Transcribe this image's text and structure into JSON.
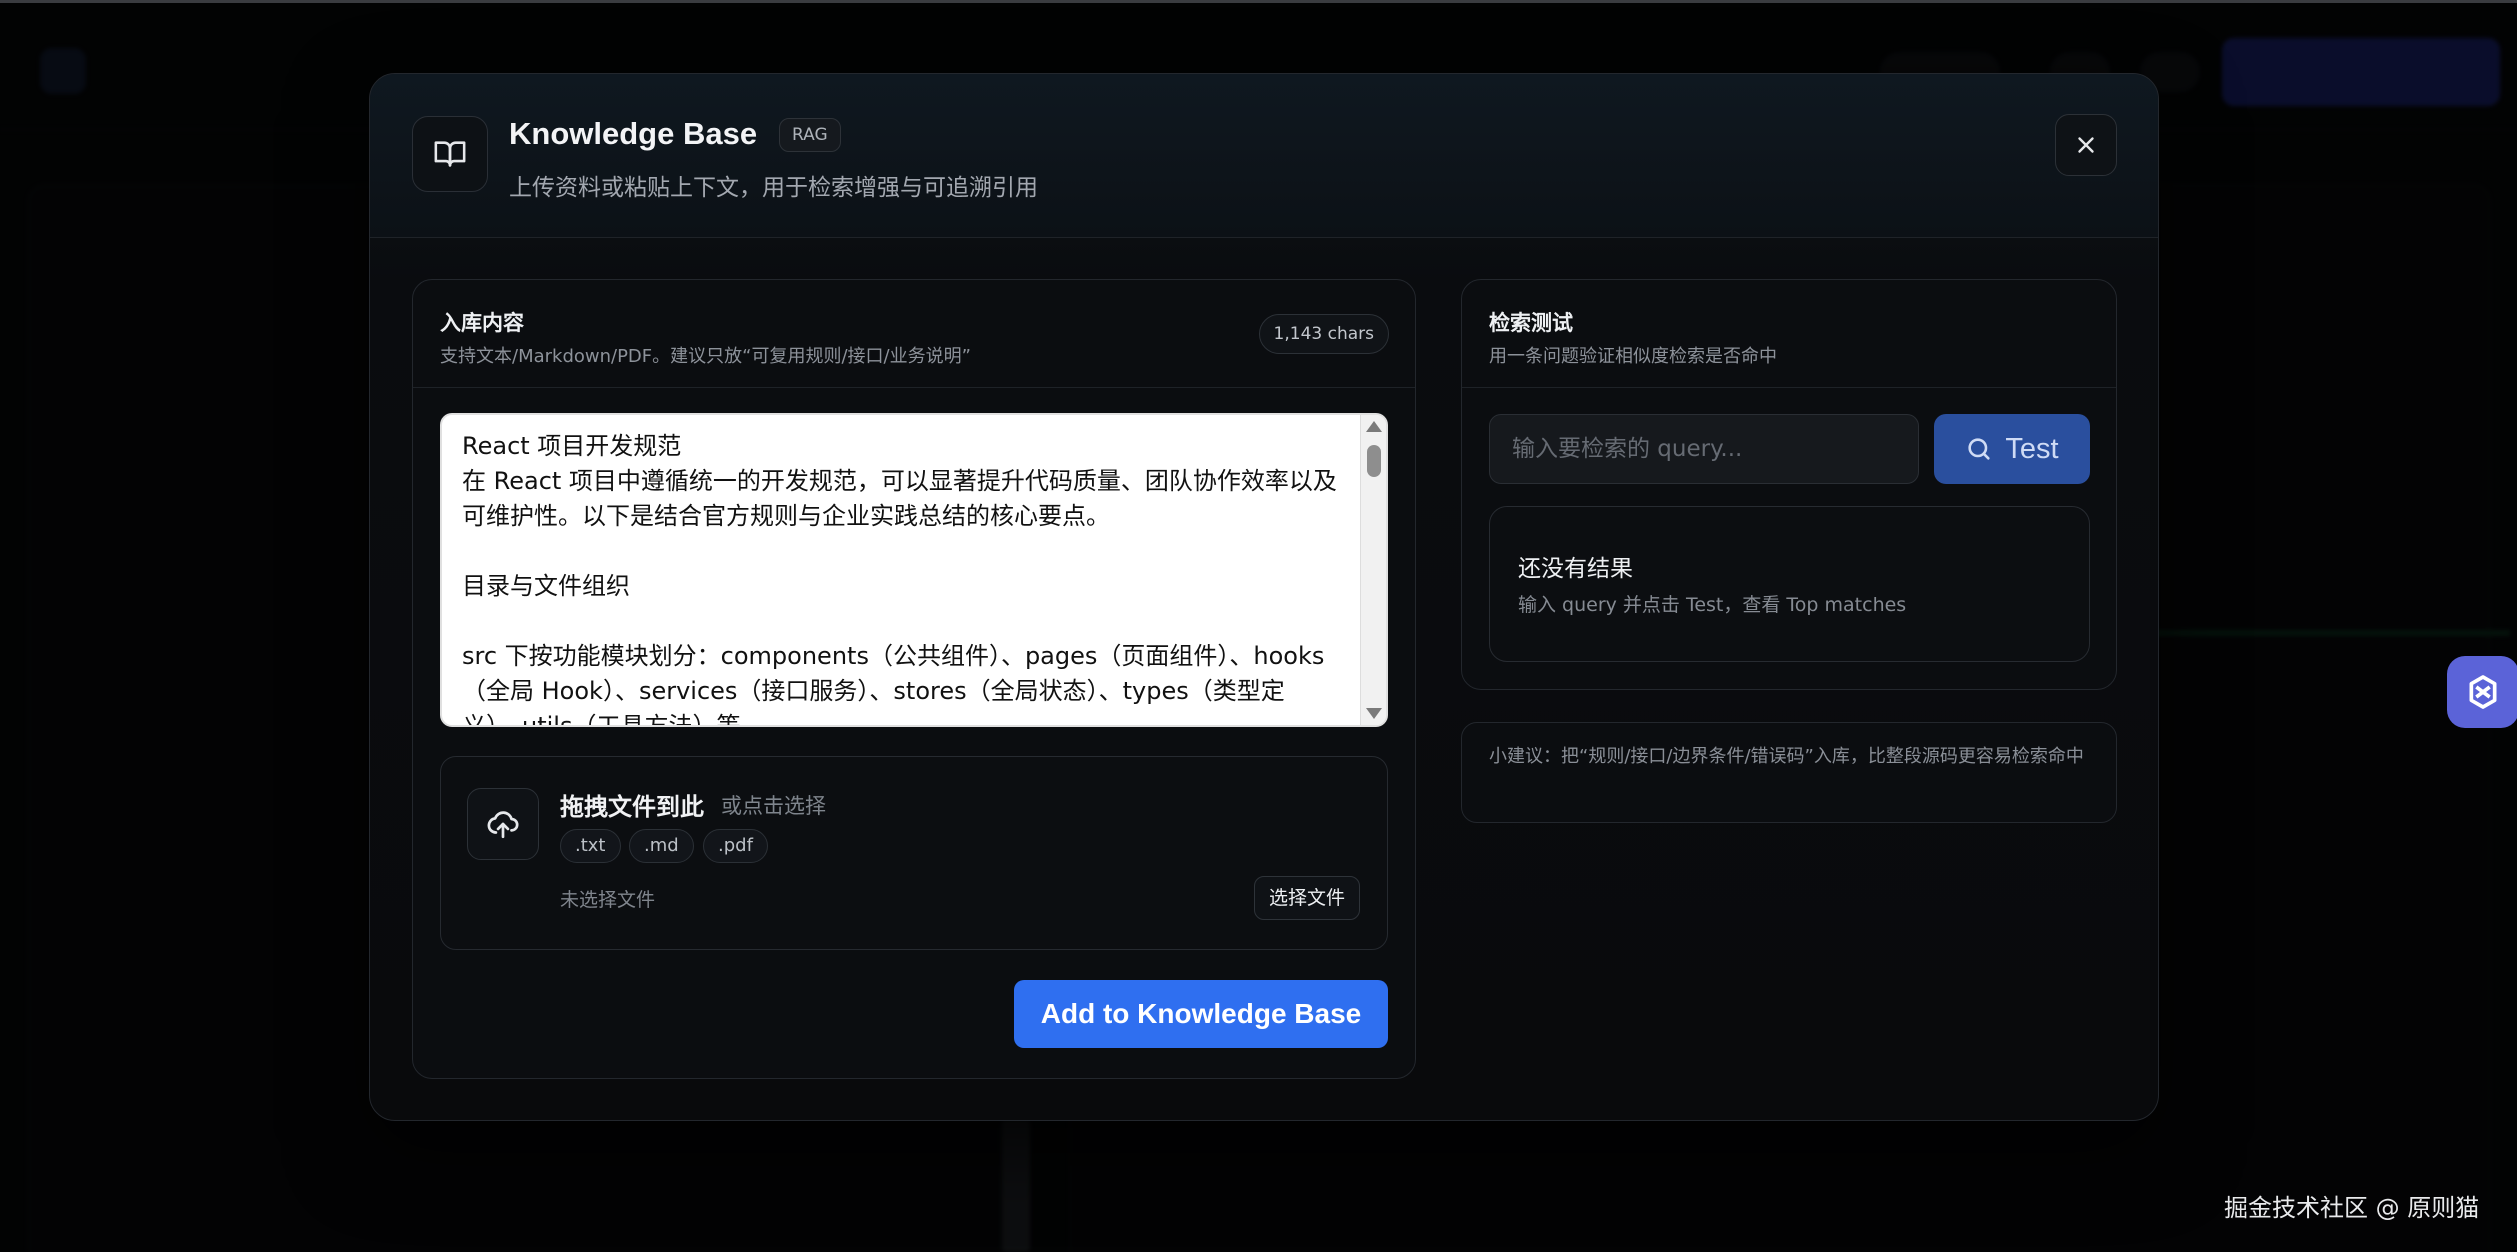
{
  "modal": {
    "title": "Knowledge Base",
    "badge": "RAG",
    "subtitle": "上传资料或粘贴上下文，用于检索增强与可追溯引用",
    "icon": "book-open-icon",
    "close_icon": "close-icon"
  },
  "ingest": {
    "title": "入库内容",
    "description": "支持文本/Markdown/PDF。建议只放“可复用规则/接口/业务说明”",
    "chars": "1,143 chars",
    "content": "React 项目开发规范\n在 React 项目中遵循统一的开发规范，可以显著提升代码质量、团队协作效率以及可维护性。以下是结合官方规则与企业实践总结的核心要点。\n\n目录与文件组织\n\nsrc 下按功能模块划分：components（公共组件）、pages（页面组件）、hooks（全局 Hook）、services（接口服务）、stores（全局状态）、types（类型定义）、utils（工具方法）等。",
    "dropzone": {
      "icon": "cloud-upload-icon",
      "title": "拖拽文件到此",
      "alt": "或点击选择",
      "extensions": [
        ".txt",
        ".md",
        ".pdf"
      ],
      "no_file": "未选择文件",
      "choose_label": "选择文件"
    },
    "add_label": "Add to Knowledge Base"
  },
  "search": {
    "title": "检索测试",
    "description": "用一条问题验证相似度检索是否命中",
    "placeholder": "输入要检索的 query...",
    "value": "",
    "test_label": "Test",
    "test_icon": "search-icon",
    "results": {
      "title": "还没有结果",
      "hint": "输入 query 并点击 Test，查看 Top matches"
    }
  },
  "tip": {
    "text": "小建议：把“规则/接口/边界条件/错误码”入库，比整段源码更容易检索命中"
  },
  "watermark": "掘金技术社区 @ 原则猫",
  "colors": {
    "accent": "#2f6ff0",
    "test_button": "#2a4f9e",
    "widget": "#5b63d8"
  }
}
